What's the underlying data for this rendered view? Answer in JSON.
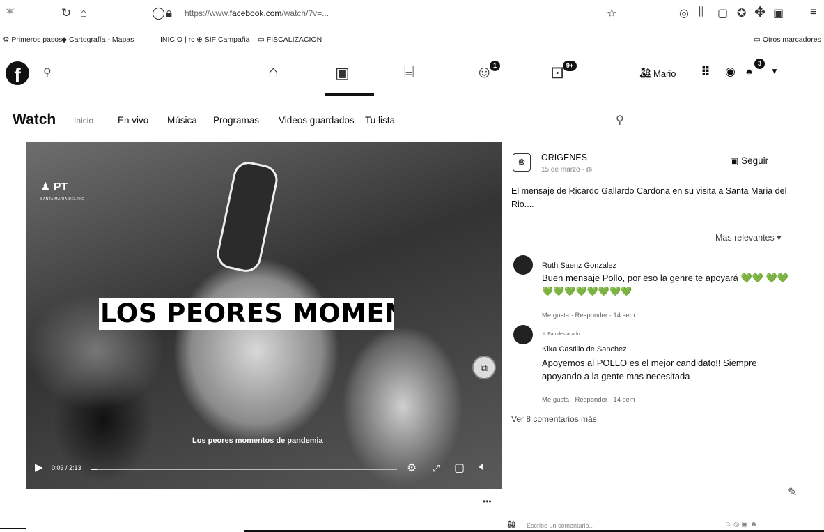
{
  "browser": {
    "url_prefix": "https://www.",
    "url_domain": "facebook.com",
    "url_rest": "/watch/?v=...",
    "bookmarks": [
      {
        "icon": "gear-icon",
        "label": "Primeros pasos"
      },
      {
        "icon": "map-icon",
        "label": "Cartografía - Mapas"
      },
      {
        "icon": "",
        "label": "INICIO | rc"
      },
      {
        "icon": "globe-icon",
        "label": "SIF Campaña"
      },
      {
        "icon": "folder-icon",
        "label": "FISCALIZACION"
      }
    ],
    "other_bookmarks": "Otros marcadores"
  },
  "fb_nav": {
    "logo": "f",
    "search_icon": "search-icon",
    "groups_badge": "1",
    "gaming_badge": "9+",
    "user_name": "Mario",
    "notifications_badge": "3"
  },
  "watch_nav": {
    "title": "Watch",
    "links": [
      "Inicio",
      "En vivo",
      "Música",
      "Programas",
      "Videos guardados",
      "Tu lista"
    ]
  },
  "video": {
    "headline": "LOS PEORES MOMENT",
    "subtitle": "Los peores momentos de pandemia",
    "logo_text": "PT",
    "logo_sub": "SANTA MARÍA DEL RÍO",
    "time": "0:03 / 2:13",
    "progress": 0.02
  },
  "post": {
    "page_name": "ORIGENES",
    "date": "15 de marzo",
    "follow_label": "Seguir",
    "description": "El mensaje de Ricardo Gallardo Cardona en su visita a Santa Maria del Rio....",
    "sort_label": "Mas relevantes"
  },
  "comments": [
    {
      "badge": "",
      "name": "Ruth Saenz Gonzalez",
      "text": "Buen mensaje Pollo, por eso la genre te apoyará 💚💚 💚💚💚💚💚💚💚💚💚💚",
      "actions": "Me gusta · Responder · 14 sem"
    },
    {
      "badge": "Fan destacado",
      "name": "Kika Castillo de Sanchez",
      "text": "Apoyemos al POLLO es el mejor candidato!! Siempre apoyando a la gente mas necesitada",
      "actions": "Me gusta · Responder · 14 sem"
    }
  ],
  "more_comments": "Ver 8 comentarios más",
  "composer_placeholder": "Escribe un comentario..."
}
